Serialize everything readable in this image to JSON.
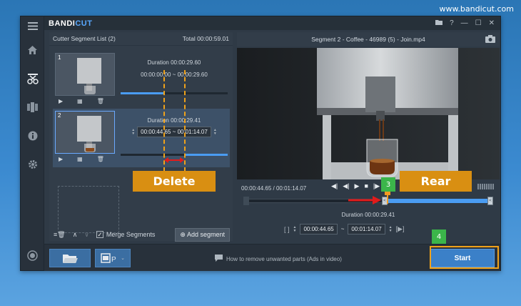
{
  "site_url": "www.bandicut.com",
  "app": {
    "logo_main": "BANDI",
    "logo_accent": "CUT",
    "accent_color": "#4a9cf2"
  },
  "rail": {
    "items": [
      {
        "name": "menu-icon"
      },
      {
        "name": "home-icon"
      },
      {
        "name": "cut-icon"
      },
      {
        "name": "join-icon"
      },
      {
        "name": "info-icon"
      },
      {
        "name": "settings-icon"
      },
      {
        "name": "record-icon"
      }
    ]
  },
  "segment_list": {
    "title": "Cutter Segment List (2)",
    "total_label": "Total 00:00:59.01",
    "segments": [
      {
        "number": "1",
        "duration": "Duration 00:00:29.60",
        "start": "00:00:00.00",
        "sep": "~",
        "end": "00:00:29.60",
        "progress": 0.4
      },
      {
        "number": "2",
        "duration": "Duration 00:00:29.41",
        "start": "00:00:44.65",
        "sep": "~",
        "end": "00:01:14.07",
        "progress": 0.4
      }
    ],
    "merge_label": "Merge Segments",
    "merge_checked": "✓",
    "add_segment_label": "Add segment"
  },
  "video": {
    "title": "Segment 2 - Coffee - 46989 (5) - Join.mp4",
    "current_time": "00:00:44.65",
    "total_time": "00:01:14.07",
    "time_sep": "/",
    "duration": "Duration 00:00:29.41",
    "start": "00:00:44.65",
    "sep": "~",
    "end": "00:01:14.07"
  },
  "bottom": {
    "tip": "How to remove unwanted parts (Ads in video)",
    "start_label": "Start"
  },
  "annotations": {
    "delete_label": "Delete",
    "rear_label": "Rear",
    "badge_3": "3",
    "badge_4": "4",
    "highlight_color": "#f0a21a",
    "badge_color": "#3bb54a",
    "arrow_color": "#e21b1b"
  }
}
